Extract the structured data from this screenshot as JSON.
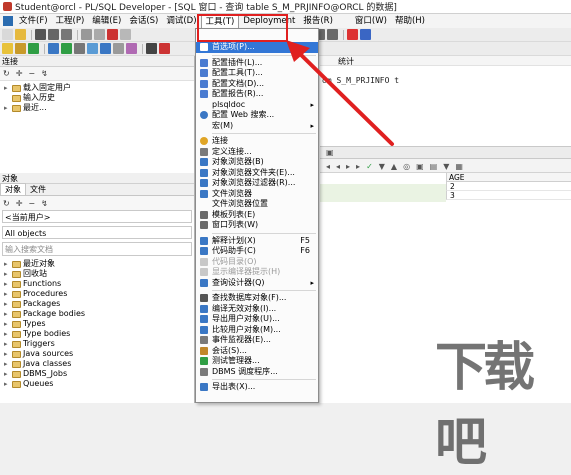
{
  "window": {
    "title": "Student@orcl - PL/SQL Developer - [SQL 窗口 - 查询 table S_M_PRJINFO@ORCL 的数据]"
  },
  "menubar": {
    "items": [
      {
        "label": "文件(F)"
      },
      {
        "label": "工程(P)"
      },
      {
        "label": "编辑(E)"
      },
      {
        "label": "会话(S)"
      },
      {
        "label": "调试(D)"
      },
      {
        "label": "工具(T)"
      },
      {
        "label": "Deployment"
      },
      {
        "label": "报告(R)"
      },
      {
        "label": "窗口(W)"
      },
      {
        "label": "帮助(H)"
      }
    ]
  },
  "connection_panel": {
    "header": "连接",
    "items": [
      "载入固定用户",
      "输入历史",
      "最近..."
    ]
  },
  "objects_panel": {
    "header": "对象",
    "tabs": [
      "对象",
      "文件"
    ],
    "current_user": "<当前用户>",
    "filter": "All objects",
    "search_placeholder": "输入搜索文档",
    "items": [
      "最近对象",
      "回收站",
      "Functions",
      "Procedures",
      "Packages",
      "Package bodies",
      "Types",
      "Type bodies",
      "Triggers",
      "Java sources",
      "Java classes",
      "DBMS_Jobs",
      "Queues"
    ]
  },
  "tools_menu": {
    "items": [
      {
        "label": "首选项(P)...",
        "icon": "wrench-icon",
        "highlight": true
      },
      {
        "sep": true
      },
      {
        "label": "配置插件(L)...",
        "icon": "plugin-icon"
      },
      {
        "label": "配置工具(T)...",
        "icon": "tools-icon"
      },
      {
        "label": "配置文档(D)...",
        "icon": "document-icon"
      },
      {
        "label": "配置报告(R)...",
        "icon": "report-icon"
      },
      {
        "label": "plsqldoc",
        "icon": "plsqldoc-icon",
        "arrow": true
      },
      {
        "label": "配置 Web 搜索...",
        "icon": "web-search-icon"
      },
      {
        "label": "宏(M)",
        "icon": "macro-icon",
        "arrow": true
      },
      {
        "sep": true
      },
      {
        "label": "连接",
        "icon": "connect-icon"
      },
      {
        "label": "定义连接...",
        "icon": "define-connection-icon"
      },
      {
        "label": "对象浏览器(B)",
        "icon": "object-browser-icon"
      },
      {
        "label": "对象浏览器文件夹(E)...",
        "icon": "folder-icon"
      },
      {
        "label": "对象浏览器过滤器(R)...",
        "icon": "filter-icon"
      },
      {
        "label": "文件浏览器",
        "icon": "file-browser-icon"
      },
      {
        "label": "文件浏览器位置",
        "icon": "file-location-icon"
      },
      {
        "label": "模板列表(E)",
        "icon": "template-icon"
      },
      {
        "label": "窗口列表(W)",
        "icon": "window-list-icon"
      },
      {
        "sep": true
      },
      {
        "label": "解释计划(X)",
        "icon": "explain-plan-icon",
        "shortcut": "F5"
      },
      {
        "label": "代码助手(C)",
        "icon": "code-assistant-icon",
        "shortcut": "F6"
      },
      {
        "label": "代码目录(O)",
        "icon": "code-contents-icon",
        "disabled": true
      },
      {
        "label": "显示编译器提示(H)",
        "icon": "compiler-hint-icon",
        "disabled": true
      },
      {
        "label": "查询设计器(Q)",
        "icon": "query-designer-icon",
        "arrow": true
      },
      {
        "sep": true
      },
      {
        "label": "查找数据库对象(F)...",
        "icon": "find-object-icon"
      },
      {
        "label": "编译无效对象(I)...",
        "icon": "compile-icon"
      },
      {
        "label": "导出用户对象(U)...",
        "icon": "export-user-icon"
      },
      {
        "label": "比较用户对象(M)...",
        "icon": "compare-icon"
      },
      {
        "label": "事件监视器(E)...",
        "icon": "event-monitor-icon"
      },
      {
        "label": "会话(S)...",
        "icon": "session-icon"
      },
      {
        "label": "测试管理器...",
        "icon": "test-manager-icon"
      },
      {
        "label": "DBMS 调度程序...",
        "icon": "scheduler-icon"
      },
      {
        "sep": true
      },
      {
        "label": "导出表(X)...",
        "icon": "export-table-icon"
      }
    ]
  },
  "sql_editor": {
    "tab": "统计",
    "sql": "om S_M_PRJINFO t"
  },
  "result_grid": {
    "columns": [
      "AGE"
    ],
    "rows": [
      [
        "2"
      ],
      [
        "3"
      ]
    ]
  },
  "annotation": {
    "color": "#e02020"
  },
  "watermark": {
    "text": "下载吧"
  },
  "colors": {
    "highlight": "#3377d6",
    "menu_bg": "#fbfbfb"
  }
}
